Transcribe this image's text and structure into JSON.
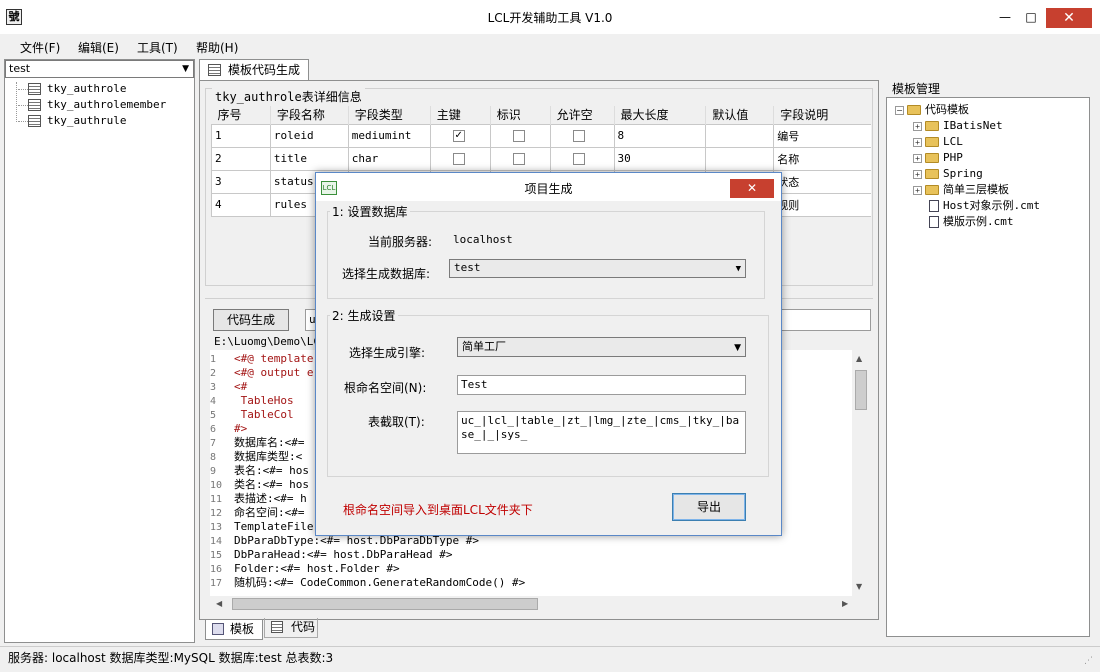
{
  "window": {
    "title": "LCL开发辅助工具 V1.0",
    "icon_label": "LCL",
    "minimize": "—",
    "maximize": "□",
    "close": "✕"
  },
  "menu": [
    "文件(F)",
    "编辑(E)",
    "工具(T)",
    "帮助(H)"
  ],
  "left": {
    "db_selected": "test",
    "tables": [
      "tky_authrole",
      "tky_authrolemember",
      "tky_authrule"
    ]
  },
  "tab": {
    "label": "模板代码生成"
  },
  "grid": {
    "title": "tky_authrole表详细信息",
    "headers": [
      "序号",
      "字段名称",
      "字段类型",
      "主键",
      "标识",
      "允许空",
      "最大长度",
      "默认值",
      "字段说明"
    ],
    "rows": [
      {
        "no": "1",
        "name": "roleid",
        "type": "mediumint",
        "pk": true,
        "ident": false,
        "nullable": false,
        "maxlen": "8",
        "default": "",
        "desc": "编号"
      },
      {
        "no": "2",
        "name": "title",
        "type": "char",
        "pk": false,
        "ident": false,
        "nullable": false,
        "maxlen": "30",
        "default": "",
        "desc": "名称"
      },
      {
        "no": "3",
        "name": "status",
        "type": "",
        "pk": false,
        "ident": false,
        "nullable": false,
        "maxlen": "",
        "default": "",
        "desc": "状态"
      },
      {
        "no": "4",
        "name": "rules",
        "type": "",
        "pk": false,
        "ident": false,
        "nullable": false,
        "maxlen": "",
        "default": "",
        "desc": "规则"
      }
    ]
  },
  "codegen": {
    "button": "代码生成",
    "path_prefix": "u",
    "path": "E:\\Luomg\\Demo\\LCL",
    "lines": [
      {
        "n": "1",
        "t": "<#@ template"
      },
      {
        "n": "2",
        "t": "<#@ output e"
      },
      {
        "n": "3",
        "t": "<#"
      },
      {
        "n": "4",
        "t": "    TableHos"
      },
      {
        "n": "5",
        "t": "    TableCol"
      },
      {
        "n": "6",
        "t": "#>"
      },
      {
        "n": "7",
        "t": "数据库名:<#="
      },
      {
        "n": "8",
        "t": "数据库类型:<"
      },
      {
        "n": "9",
        "t": "表名:<#= hos"
      },
      {
        "n": "10",
        "t": "类名:<#= hos"
      },
      {
        "n": "11",
        "t": "表描述:<#= h"
      },
      {
        "n": "12",
        "t": "命名空间:<#="
      },
      {
        "n": "13",
        "t": "TemplateFile"
      },
      {
        "n": "14",
        "t": "DbParaDbType:<#= host.DbParaDbType #>"
      },
      {
        "n": "15",
        "t": "DbParaHead:<#= host.DbParaHead #>"
      },
      {
        "n": "16",
        "t": "Folder:<#= host.Folder #>"
      },
      {
        "n": "17",
        "t": "随机码:<#= CodeCommon.GenerateRandomCode() #>"
      }
    ]
  },
  "bottom_tabs": [
    "模板",
    "代码"
  ],
  "templates": {
    "title": "模板管理",
    "root": "代码模板",
    "folders": [
      "IBatisNet",
      "LCL",
      "PHP",
      "Spring",
      "简单三层模板"
    ],
    "files": [
      "Host对象示例.cmt",
      "模版示例.cmt"
    ]
  },
  "dialog": {
    "title": "项目生成",
    "icon_label": "LCL",
    "close": "✕",
    "group1": "1: 设置数据库",
    "server_label": "当前服务器:",
    "server_value": "localhost",
    "db_label": "选择生成数据库:",
    "db_value": "test",
    "group2": "2: 生成设置",
    "engine_label": "选择生成引擎:",
    "engine_value": "简单工厂",
    "ns_label": "根命名空间(N):",
    "ns_value": "Test",
    "trim_label": "表截取(T):",
    "trim_value": "uc_|lcl_|table_|zt_|lmg_|zte_|cms_|tky_|base_|_|sys_",
    "hint": "根命名空间导入到桌面LCL文件夹下",
    "export": "导出"
  },
  "status": {
    "text": "服务器: localhost 数据库类型:MySQL 数据库:test 总表数:3"
  },
  "colors": {
    "close_red": "#c7402f",
    "hint_red": "#c00000",
    "dialog_border": "#5a88c7"
  }
}
